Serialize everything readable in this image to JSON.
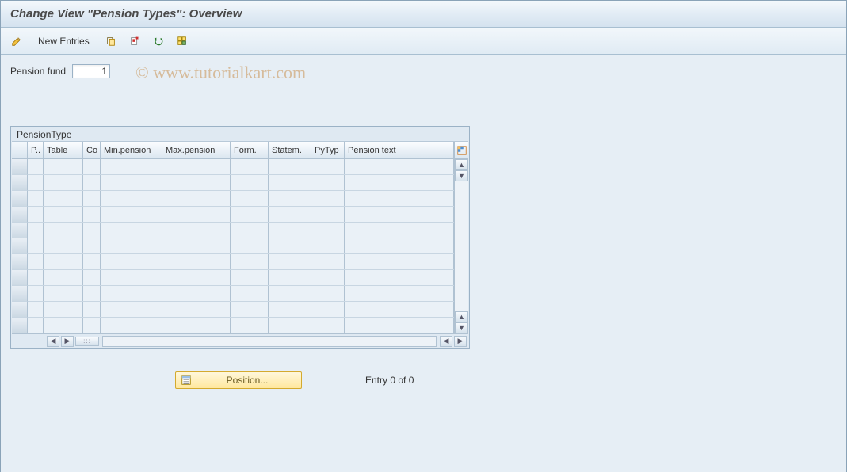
{
  "title": "Change View \"Pension Types\": Overview",
  "watermark": "© www.tutorialkart.com",
  "toolbar": {
    "new_entries": "New Entries",
    "icons": {
      "edit": "edit-pencil-icon",
      "copy": "copy-icon",
      "delete": "delete-icon",
      "select_all": "select-all-icon",
      "table_settings": "table-settings-icon"
    }
  },
  "fields": {
    "pension_fund": {
      "label": "Pension fund",
      "value": "1"
    }
  },
  "table": {
    "title": "PensionType",
    "columns": [
      "P..",
      "Table",
      "Co",
      "Min.pension",
      "Max.pension",
      "Form.",
      "Statem.",
      "PyTyp",
      "Pension text"
    ],
    "rows": [],
    "visible_empty_rows": 11
  },
  "footer": {
    "position_label": "Position...",
    "status": "Entry 0 of 0"
  }
}
